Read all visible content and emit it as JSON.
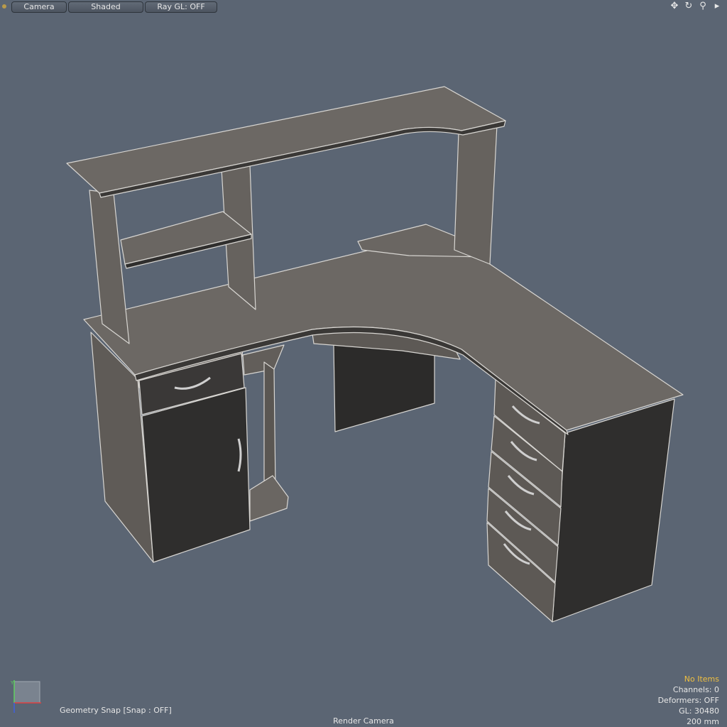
{
  "toolbar": {
    "camera_label": "Camera",
    "shading_label": "Shaded",
    "raygl_label": "Ray GL: OFF",
    "icons": [
      "move-icon",
      "rotate-icon",
      "zoom-icon",
      "expand-icon"
    ]
  },
  "status": {
    "snap": "Geometry Snap  [Snap : OFF]",
    "camera": "Render Camera"
  },
  "info": {
    "items": "No Items",
    "channels": "Channels: 0",
    "deformers": "Deformers: OFF",
    "gl": "GL: 30480",
    "scale": "200 mm"
  },
  "axis": {
    "y_label": "Y"
  },
  "colors": {
    "background": "#5b6573",
    "desk_top": "#6c6864",
    "desk_side": "#5f5b57",
    "front_panel": "#2f2e2d",
    "wire": "#d8d6d2",
    "highlight_text": "#f0c040"
  }
}
